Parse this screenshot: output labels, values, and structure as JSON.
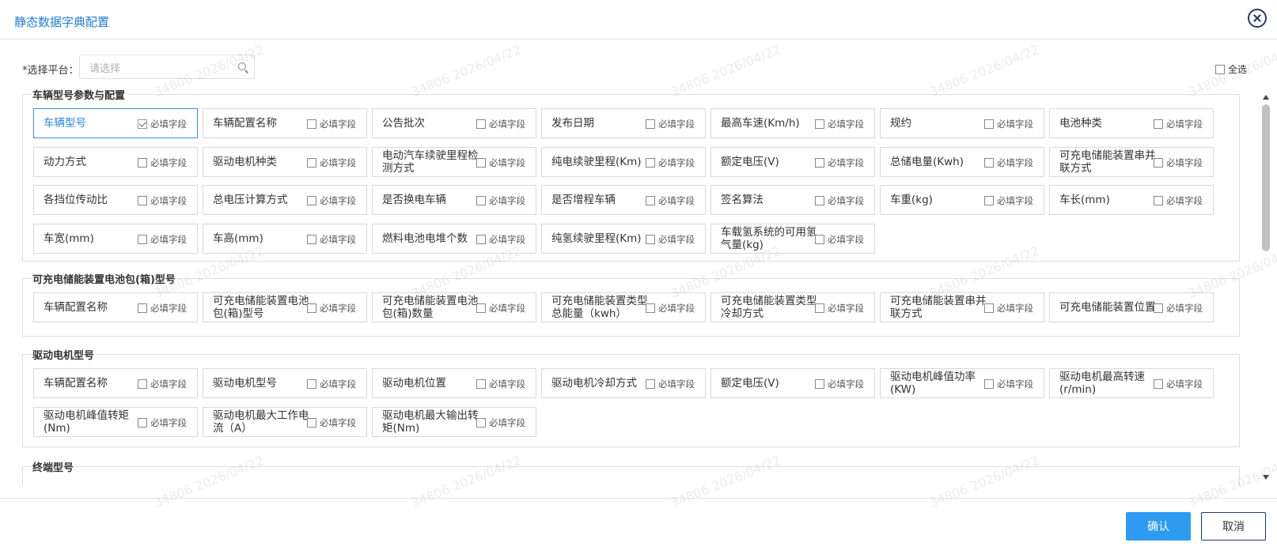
{
  "dialog": {
    "title": "静态数据字典配置",
    "platform_label": "*选择平台：",
    "platform_placeholder": "请选择",
    "select_all_label": "全选",
    "confirm_label": "确认",
    "cancel_label": "取消",
    "required_text": "必填字段",
    "watermark": "34806 2026/04/22"
  },
  "sections": [
    {
      "title": "车辆型号参数与配置",
      "fields": [
        {
          "label": "车辆型号",
          "required": true
        },
        {
          "label": "车辆配置名称",
          "required": false
        },
        {
          "label": "公告批次",
          "required": false
        },
        {
          "label": "发布日期",
          "required": false
        },
        {
          "label": "最高车速(Km/h)",
          "required": false
        },
        {
          "label": "规约",
          "required": false
        },
        {
          "label": "电池种类",
          "required": false
        },
        {
          "label": "动力方式",
          "required": false
        },
        {
          "label": "驱动电机种类",
          "required": false
        },
        {
          "label": "电动汽车续驶里程检测方式",
          "required": false
        },
        {
          "label": "纯电续驶里程(Km)",
          "required": false
        },
        {
          "label": "额定电压(V)",
          "required": false
        },
        {
          "label": "总储电量(Kwh)",
          "required": false
        },
        {
          "label": "可充电储能装置串并联方式",
          "required": false
        },
        {
          "label": "各挡位传动比",
          "required": false
        },
        {
          "label": "总电压计算方式",
          "required": false
        },
        {
          "label": "是否换电车辆",
          "required": false
        },
        {
          "label": "是否增程车辆",
          "required": false
        },
        {
          "label": "签名算法",
          "required": false
        },
        {
          "label": "车重(kg)",
          "required": false
        },
        {
          "label": "车长(mm)",
          "required": false
        },
        {
          "label": "车宽(mm)",
          "required": false
        },
        {
          "label": "车高(mm)",
          "required": false
        },
        {
          "label": "燃料电池电堆个数",
          "required": false
        },
        {
          "label": "纯氢续驶里程(Km)",
          "required": false
        },
        {
          "label": "车载氢系统的可用氢气量(kg)",
          "required": false
        }
      ]
    },
    {
      "title": "可充电储能装置电池包(箱)型号",
      "fields": [
        {
          "label": "车辆配置名称",
          "required": false
        },
        {
          "label": "可充电储能装置电池包(箱)型号",
          "required": false
        },
        {
          "label": "可充电储能装置电池包(箱)数量",
          "required": false
        },
        {
          "label": "可充电储能装置类型总能量（kwh）",
          "required": false
        },
        {
          "label": "可充电储能装置类型冷却方式",
          "required": false
        },
        {
          "label": "可充电储能装置串并联方式",
          "required": false
        },
        {
          "label": "可充电储能装置位置",
          "required": false
        }
      ]
    },
    {
      "title": "驱动电机型号",
      "fields": [
        {
          "label": "车辆配置名称",
          "required": false
        },
        {
          "label": "驱动电机型号",
          "required": false
        },
        {
          "label": "驱动电机位置",
          "required": false
        },
        {
          "label": "驱动电机冷却方式",
          "required": false
        },
        {
          "label": "额定电压(V)",
          "required": false
        },
        {
          "label": "驱动电机峰值功率(KW)",
          "required": false
        },
        {
          "label": "驱动电机最高转速(r/min)",
          "required": false
        },
        {
          "label": "驱动电机峰值转矩(Nm)",
          "required": false
        },
        {
          "label": "驱动电机最大工作电流（A）",
          "required": false
        },
        {
          "label": "驱动电机最大输出转矩(Nm)",
          "required": false
        }
      ]
    },
    {
      "title": "终端型号",
      "fields": []
    }
  ]
}
